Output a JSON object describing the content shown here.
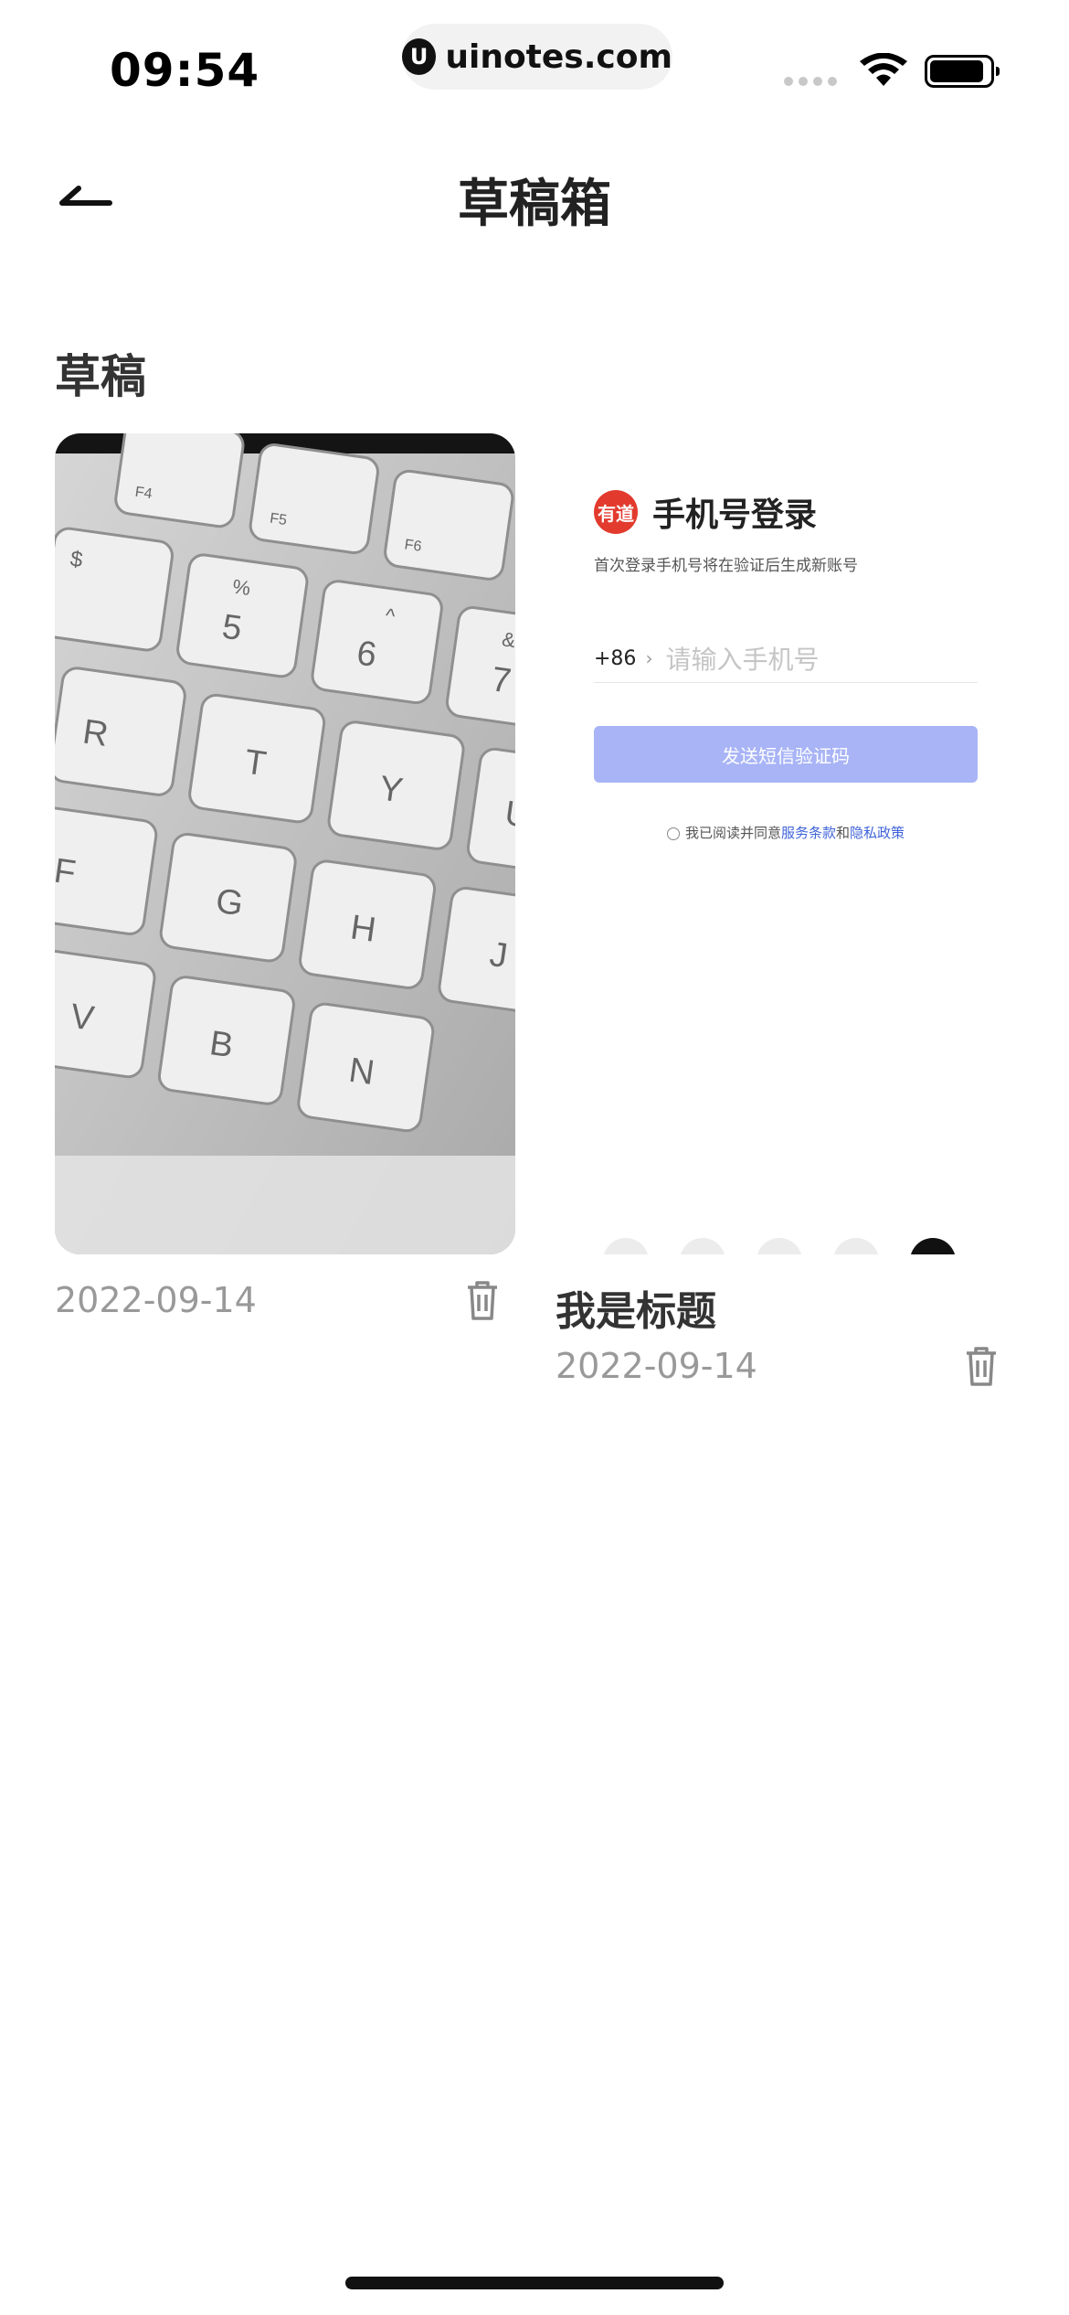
{
  "status_bar": {
    "time": "09:54",
    "url": "uinotes.com",
    "url_logo": "U"
  },
  "nav": {
    "title": "草稿箱",
    "back_icon": "arrow-left-icon"
  },
  "section": {
    "title": "草稿"
  },
  "drafts": [
    {
      "type": "image",
      "date": "2022-09-14",
      "trash_icon": "trash-icon"
    },
    {
      "type": "screenshot",
      "title": "我是标题",
      "date": "2022-09-14",
      "trash_icon": "trash-icon",
      "preview": {
        "logo_text": "有道",
        "heading": "手机号登录",
        "subtitle": "首次登录手机号将在验证后生成新账号",
        "country_code": "+86",
        "chevron": "›",
        "phone_placeholder": "请输入手机号",
        "button_label": "发送短信验证码",
        "agree_prefix": "我已阅读并同意",
        "terms": "服务条款",
        "and": "和",
        "privacy": "隐私政策",
        "button_color": "#a8b4f6",
        "link_color": "#3f63d8"
      }
    }
  ],
  "keyboard": {
    "row1": [
      "F4",
      "F5",
      "F6"
    ],
    "row2": [
      [
        "$",
        ""
      ],
      [
        "%",
        "5"
      ],
      [
        "^",
        "6"
      ],
      [
        "&",
        "7"
      ]
    ],
    "row3": [
      "R",
      "T",
      "Y",
      "U"
    ],
    "row4": [
      "F",
      "G",
      "H",
      "J"
    ],
    "row5": [
      "V",
      "B",
      "N"
    ]
  }
}
